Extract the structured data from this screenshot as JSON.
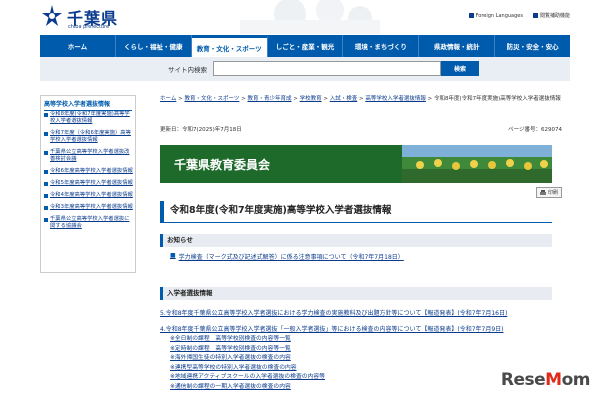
{
  "header": {
    "logo_title": "千葉県",
    "logo_subtitle": "chiba prefecture",
    "links": [
      "Foreign Languages",
      "閲覧補助機能"
    ]
  },
  "nav": {
    "items": [
      "ホーム",
      "くらし・福祉・健康",
      "教育・文化・スポーツ",
      "しごと・産業・観光",
      "環境・まちづくり",
      "県政情報・統計",
      "防災・安全・安心"
    ]
  },
  "search": {
    "label": "サイト内検索",
    "placeholder": "",
    "button": "検索"
  },
  "sidebar": {
    "title": "高等学校入学者選抜情報",
    "items": [
      "令和8年度(令和7年度実施)高等学校入学者選抜情報",
      "令和7年度（令和6年度実施）高等学校入学者選抜情報",
      "千葉県公立高等学校入学者選抜改善検討会議",
      "令和6年度高等学校入学者選抜情報",
      "令和5年度高等学校入学者選抜情報",
      "令和4年度高等学校入学者選抜情報",
      "令和3年度高等学校入学者選抜情報",
      "千葉県公立高等学校入学者選抜に関する協議会"
    ]
  },
  "breadcrumb": {
    "items": [
      "ホーム",
      "教育・文化・スポーツ",
      "教育・青少年育成",
      "学校教育",
      "入試・検査",
      "高等学校入学者選抜情報"
    ],
    "current": "令和8年度(令和7年度実施)高等学校入学者選抜情報"
  },
  "meta": {
    "updated": "更新日：令和7(2025)年7月18日",
    "page_id": "ページ番号：629074"
  },
  "banner": {
    "title": "千葉県教育委員会"
  },
  "print_label": "印刷",
  "page_title": "令和8年度(令和7年度実施)高等学校入学者選抜情報",
  "notice": {
    "heading": "お知らせ",
    "items": [
      "学力検査（マーク式及び記述式解答）に係る注意事項について（令和7年7月18日）"
    ]
  },
  "exam": {
    "heading": "入学者選抜情報",
    "items": [
      "5.令和8年度千葉県公立高等学校入学者選抜における学力検査の実施教科及び出題方針等について【報道発表】(令和7年7月16日)",
      "4.令和8年度千葉県公立高等学校入学者選抜「一般入学者選抜」等における検査の内容等について【報道発表】(令和7年7月9日)"
    ],
    "sub_items": [
      "※全日制の課程　高等学校別検査の内容等一覧",
      "※定時制の課程　高等学校別検査の内容等一覧",
      "※海外帰国生徒の特別入学者選抜の検査の内容",
      "※連携型高等学校の特別入学者選抜の検査の内容",
      "※地域連携アクティブスクールの入学者選抜の検査の内容等",
      "※通信制の課程の一期入学者選抜の検査の内容"
    ]
  },
  "watermark": {
    "prefix": "Rese",
    "m": "M",
    "suffix": "om"
  },
  "colors": {
    "nav_blue": "#005bac",
    "banner_green": "#1d6a2a",
    "link": "#0b3b8c"
  }
}
